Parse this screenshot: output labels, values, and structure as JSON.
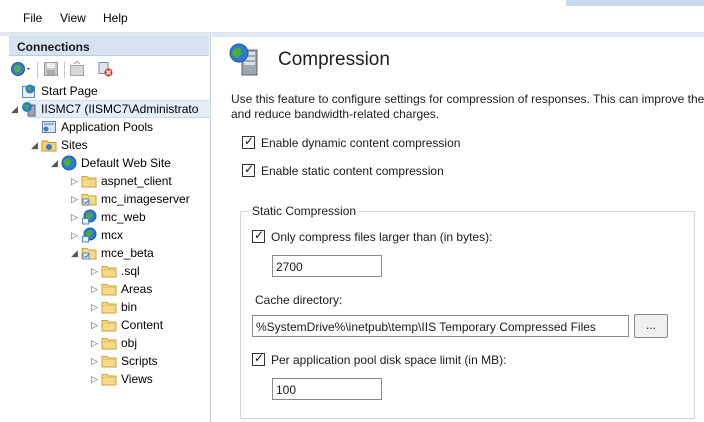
{
  "menu": {
    "file": "File",
    "view": "View",
    "help": "Help"
  },
  "connections": {
    "header": "Connections",
    "tree": [
      {
        "label": "Start Page",
        "icon": "start-page-icon"
      },
      {
        "label": "IISMC7 (IISMC7\\Administrato",
        "icon": "server-icon"
      },
      {
        "label": "Application Pools",
        "icon": "app-pools-icon"
      },
      {
        "label": "Sites",
        "icon": "sites-icon"
      },
      {
        "label": "Default Web Site",
        "icon": "globe-icon"
      },
      {
        "label": "aspnet_client",
        "icon": "folder-icon"
      },
      {
        "label": "mc_imageserver",
        "icon": "application-folder-icon"
      },
      {
        "label": "mc_web",
        "icon": "web-application-icon"
      },
      {
        "label": "mcx",
        "icon": "web-application-icon"
      },
      {
        "label": "mce_beta",
        "icon": "application-folder-icon"
      },
      {
        "label": ".sql",
        "icon": "folder-icon"
      },
      {
        "label": "Areas",
        "icon": "folder-icon"
      },
      {
        "label": "bin",
        "icon": "folder-icon"
      },
      {
        "label": "Content",
        "icon": "folder-icon"
      },
      {
        "label": "obj",
        "icon": "folder-icon"
      },
      {
        "label": "Scripts",
        "icon": "folder-icon"
      },
      {
        "label": "Views",
        "icon": "folder-icon"
      }
    ]
  },
  "page": {
    "title": "Compression",
    "description_line1": "Use this feature to configure settings for compression of responses. This can improve the p",
    "description_line2": "and reduce bandwidth-related charges.",
    "dynamic_label": "Enable dynamic content compression",
    "dynamic_checked": true,
    "static_label": "Enable static content compression",
    "static_checked": true,
    "static_group": {
      "title": "Static Compression",
      "only_larger_label": "Only compress files larger than (in bytes):",
      "only_larger_checked": true,
      "min_size_value": "2700",
      "cache_dir_label": "Cache directory:",
      "cache_dir_value": "%SystemDrive%\\inetpub\\temp\\IIS Temporary Compressed Files",
      "browse_label": "...",
      "per_pool_label": "Per application pool disk space limit (in MB):",
      "per_pool_checked": true,
      "per_pool_value": "100"
    }
  },
  "colors": {
    "header_bg": "#d6e3f2",
    "selection_bg": "#e4eef9",
    "accent_strip": "#dfe9f5"
  }
}
